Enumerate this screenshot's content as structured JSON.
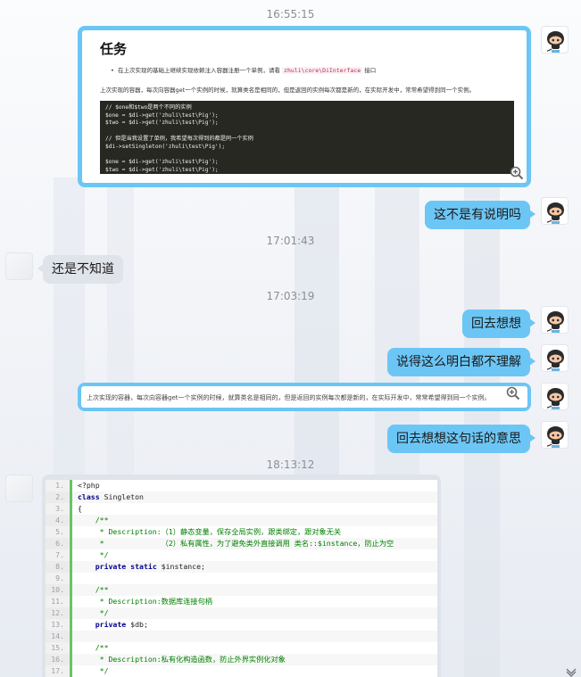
{
  "timestamps": [
    "16:55:15",
    "17:01:43",
    "17:03:19",
    "18:13:12"
  ],
  "task_image": {
    "title": "任务",
    "bullet_prefix": "在上次实现的基础上继续实现依赖注入容器注册一个单例，请看",
    "bullet_code": "zhuli\\core\\DiInterface",
    "bullet_suffix": "接口",
    "paragraph": "上次实现的容器，每次向容器get一个实例的时候，就算类名是相同的，但是返回的实例每次都是新的，在实际开发中，常常希望得到同一个实例。",
    "code_lines": [
      "// $one和$two是两个不同的实例",
      "$one = $di->get('zhuli\\test\\Pig');",
      "$two = $di->get('zhuli\\test\\Pig');",
      "",
      "// 但是当我设置了单例，我希望每次得到的都是同一个实例",
      "$di->setSingleton('zhuli\\test\\Pig');",
      "",
      "$one = $di->get('zhuli\\test\\Pig');",
      "$two = $di->get('zhuli\\test\\Pig');"
    ]
  },
  "messages": {
    "m1": "这不是有说明吗",
    "m2": "还是不知道",
    "m3": "回去想想",
    "m4": "说得这么明白都不理解",
    "m5": "回去想想这句话的意思"
  },
  "quote_image": {
    "text": "上次实现的容器，每次向容器get一个实例的时候，就算类名是相同的，但是返回的实例每次都是新的，在实际开发中，常常希望得到同一个实例。"
  },
  "code_block": {
    "lines": [
      {
        "n": "1.",
        "t": "<?php"
      },
      {
        "n": "2.",
        "t": "class Singleton"
      },
      {
        "n": "3.",
        "t": "{"
      },
      {
        "n": "4.",
        "t": "    /**"
      },
      {
        "n": "5.",
        "t": "     * Description:（1）静态变量，保存全局实例，跟类绑定，跟对象无关"
      },
      {
        "n": "6.",
        "t": "     *             （2）私有属性，为了避免类外直接调用 类名::$instance，防止为空"
      },
      {
        "n": "7.",
        "t": "     */"
      },
      {
        "n": "8.",
        "t": "    private static $instance;"
      },
      {
        "n": "9.",
        "t": ""
      },
      {
        "n": "10.",
        "t": "    /**"
      },
      {
        "n": "11.",
        "t": "     * Description:数据库连接句柄"
      },
      {
        "n": "12.",
        "t": "     */"
      },
      {
        "n": "13.",
        "t": "    private $db;"
      },
      {
        "n": "14.",
        "t": ""
      },
      {
        "n": "15.",
        "t": "    /**"
      },
      {
        "n": "16.",
        "t": "     * Description:私有化构造函数，防止外界实例化对象"
      },
      {
        "n": "17.",
        "t": "     */"
      }
    ]
  },
  "colors": {
    "bubble_self": "#6cc6f5",
    "bubble_other": "#dfe3ea",
    "timestamp": "#8b8f95"
  },
  "icons": [
    "octocat-avatar-icon",
    "blank-avatar-icon",
    "zoom-in-icon",
    "chevron-down-icon"
  ]
}
